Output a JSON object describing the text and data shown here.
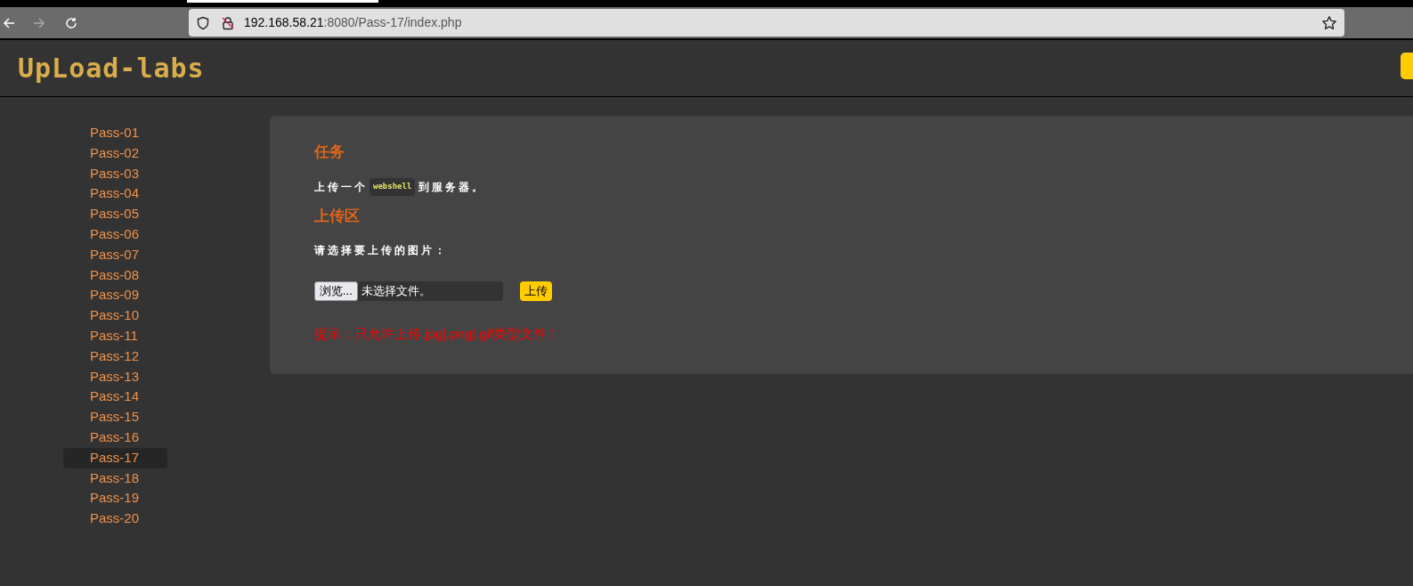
{
  "browser": {
    "url_host": "192.168.58.21",
    "url_rest": ":8080/Pass-17/index.php"
  },
  "header": {
    "logo": "UpLoad-labs"
  },
  "sidebar": {
    "items": [
      {
        "label": "Pass-01",
        "selected": false
      },
      {
        "label": "Pass-02",
        "selected": false
      },
      {
        "label": "Pass-03",
        "selected": false
      },
      {
        "label": "Pass-04",
        "selected": false
      },
      {
        "label": "Pass-05",
        "selected": false
      },
      {
        "label": "Pass-06",
        "selected": false
      },
      {
        "label": "Pass-07",
        "selected": false
      },
      {
        "label": "Pass-08",
        "selected": false
      },
      {
        "label": "Pass-09",
        "selected": false
      },
      {
        "label": "Pass-10",
        "selected": false
      },
      {
        "label": "Pass-11",
        "selected": false
      },
      {
        "label": "Pass-12",
        "selected": false
      },
      {
        "label": "Pass-13",
        "selected": false
      },
      {
        "label": "Pass-14",
        "selected": false
      },
      {
        "label": "Pass-15",
        "selected": false
      },
      {
        "label": "Pass-16",
        "selected": false
      },
      {
        "label": "Pass-17",
        "selected": true
      },
      {
        "label": "Pass-18",
        "selected": false
      },
      {
        "label": "Pass-19",
        "selected": false
      },
      {
        "label": "Pass-20",
        "selected": false
      }
    ]
  },
  "task": {
    "heading": "任务",
    "text_before": "上传一个",
    "code": "webshell",
    "text_after": "到服务器。"
  },
  "upload": {
    "heading": "上传区",
    "prompt": "请选择要上传的图片：",
    "browse_button": "浏览...",
    "file_status": "未选择文件。",
    "submit_button": "上传",
    "hint": "提示：只允许上传.jpg|.png|.gif类型文件！"
  }
}
